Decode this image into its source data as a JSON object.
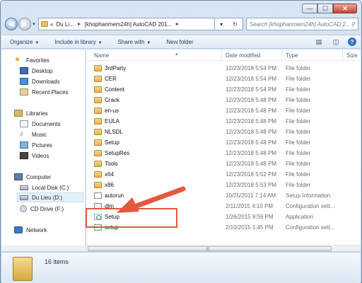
{
  "window": {
    "minimize_glyph": "—",
    "maximize_glyph": "☐",
    "close_glyph": "✕"
  },
  "nav": {
    "back_glyph": "◀",
    "forward_glyph": "▶"
  },
  "address": {
    "overflow_glyph": "«",
    "segments": [
      "Du Li...",
      "[khophanmem24h] AutoCAD 201..."
    ],
    "dropdown_glyph": "▾",
    "refresh_glyph": "↻"
  },
  "search": {
    "placeholder": "Search [khophanmem24h] AutoCAD 2..."
  },
  "toolbar": {
    "organize": "Organize",
    "include_library": "Include in library",
    "share_with": "Share with",
    "new_folder": "New folder"
  },
  "sidebar": {
    "favorites": "Favorites",
    "desktop": "Desktop",
    "downloads": "Downloads",
    "recent": "Recent Places",
    "libraries": "Libraries",
    "documents": "Documents",
    "music": "Music",
    "pictures": "Pictures",
    "videos": "Videos",
    "computer": "Computer",
    "local_disk": "Local Disk (C:)",
    "du_lieu": "Du Lieu (D:)",
    "cd_drive": "CD Drive (F:)",
    "network": "Network"
  },
  "columns": {
    "name": "Name",
    "date": "Date modified",
    "type": "Type",
    "size": "Size"
  },
  "files": [
    {
      "name": "3rdParty",
      "date": "12/23/2018 5:54 PM",
      "type": "File folder",
      "icon": "folder"
    },
    {
      "name": "CER",
      "date": "12/23/2018 5:54 PM",
      "type": "File folder",
      "icon": "folder"
    },
    {
      "name": "Content",
      "date": "12/23/2018 5:54 PM",
      "type": "File folder",
      "icon": "folder"
    },
    {
      "name": "Crack",
      "date": "12/23/2018 5:48 PM",
      "type": "File folder",
      "icon": "folder"
    },
    {
      "name": "en-us",
      "date": "12/23/2018 5:48 PM",
      "type": "File folder",
      "icon": "folder"
    },
    {
      "name": "EULA",
      "date": "12/23/2018 5:48 PM",
      "type": "File folder",
      "icon": "folder"
    },
    {
      "name": "NLSDL",
      "date": "12/23/2018 5:48 PM",
      "type": "File folder",
      "icon": "folder"
    },
    {
      "name": "Setup",
      "date": "12/23/2018 5:48 PM",
      "type": "File folder",
      "icon": "folder"
    },
    {
      "name": "SetupRes",
      "date": "12/23/2018 5:48 PM",
      "type": "File folder",
      "icon": "folder"
    },
    {
      "name": "Tools",
      "date": "12/23/2018 5:48 PM",
      "type": "File folder",
      "icon": "folder"
    },
    {
      "name": "x64",
      "date": "12/23/2018 5:52 PM",
      "type": "File folder",
      "icon": "folder"
    },
    {
      "name": "x86",
      "date": "12/23/2018 5:53 PM",
      "type": "File folder",
      "icon": "folder"
    },
    {
      "name": "autorun",
      "date": "10/25/2011 7:14 AM",
      "type": "Setup Information",
      "icon": "info"
    },
    {
      "name": "dlm",
      "date": "2/11/2015 4:10 PM",
      "type": "Configuration sett...",
      "icon": "cfg"
    },
    {
      "name": "Setup",
      "date": "1/26/2015 9:59 PM",
      "type": "Application",
      "icon": "app"
    },
    {
      "name": "setup",
      "date": "2/10/2015 1:45 PM",
      "type": "Configuration sett...",
      "icon": "cfg"
    }
  ],
  "status": {
    "count_text": "16 items"
  },
  "annotation": {
    "highlight_color": "#e4573f"
  }
}
